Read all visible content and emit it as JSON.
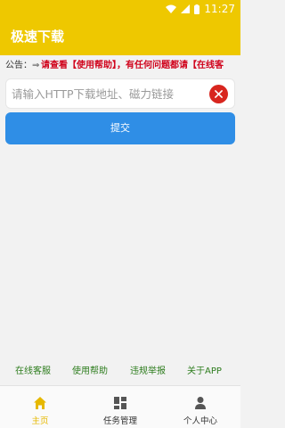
{
  "status_bar": {
    "time": "11:27",
    "icons": [
      "wifi-icon",
      "signal-icon",
      "battery-icon"
    ]
  },
  "app": {
    "title": "极速下载"
  },
  "notice": {
    "label": "公告：",
    "arrow": "⇒",
    "text": "请查看【使用帮助】，有任何问题都请【在线客"
  },
  "search": {
    "placeholder": "请输入HTTP下载地址、磁力链接",
    "value": ""
  },
  "submit": {
    "label": "提交"
  },
  "links": [
    {
      "label": "在线客服"
    },
    {
      "label": "使用帮助"
    },
    {
      "label": "违规举报"
    },
    {
      "label": "关于APP"
    }
  ],
  "nav": {
    "items": [
      {
        "label": "主页",
        "icon": "home-icon",
        "active": true
      },
      {
        "label": "任务管理",
        "icon": "grid-icon",
        "active": false
      },
      {
        "label": "个人中心",
        "icon": "person-icon",
        "active": false
      }
    ]
  },
  "colors": {
    "brand": "#eec800",
    "primary_button": "#2f8ee6",
    "clear_button": "#d8261f",
    "link": "#2e7d1e",
    "notice_text": "#d0021b",
    "nav_active": "#e6b800"
  }
}
